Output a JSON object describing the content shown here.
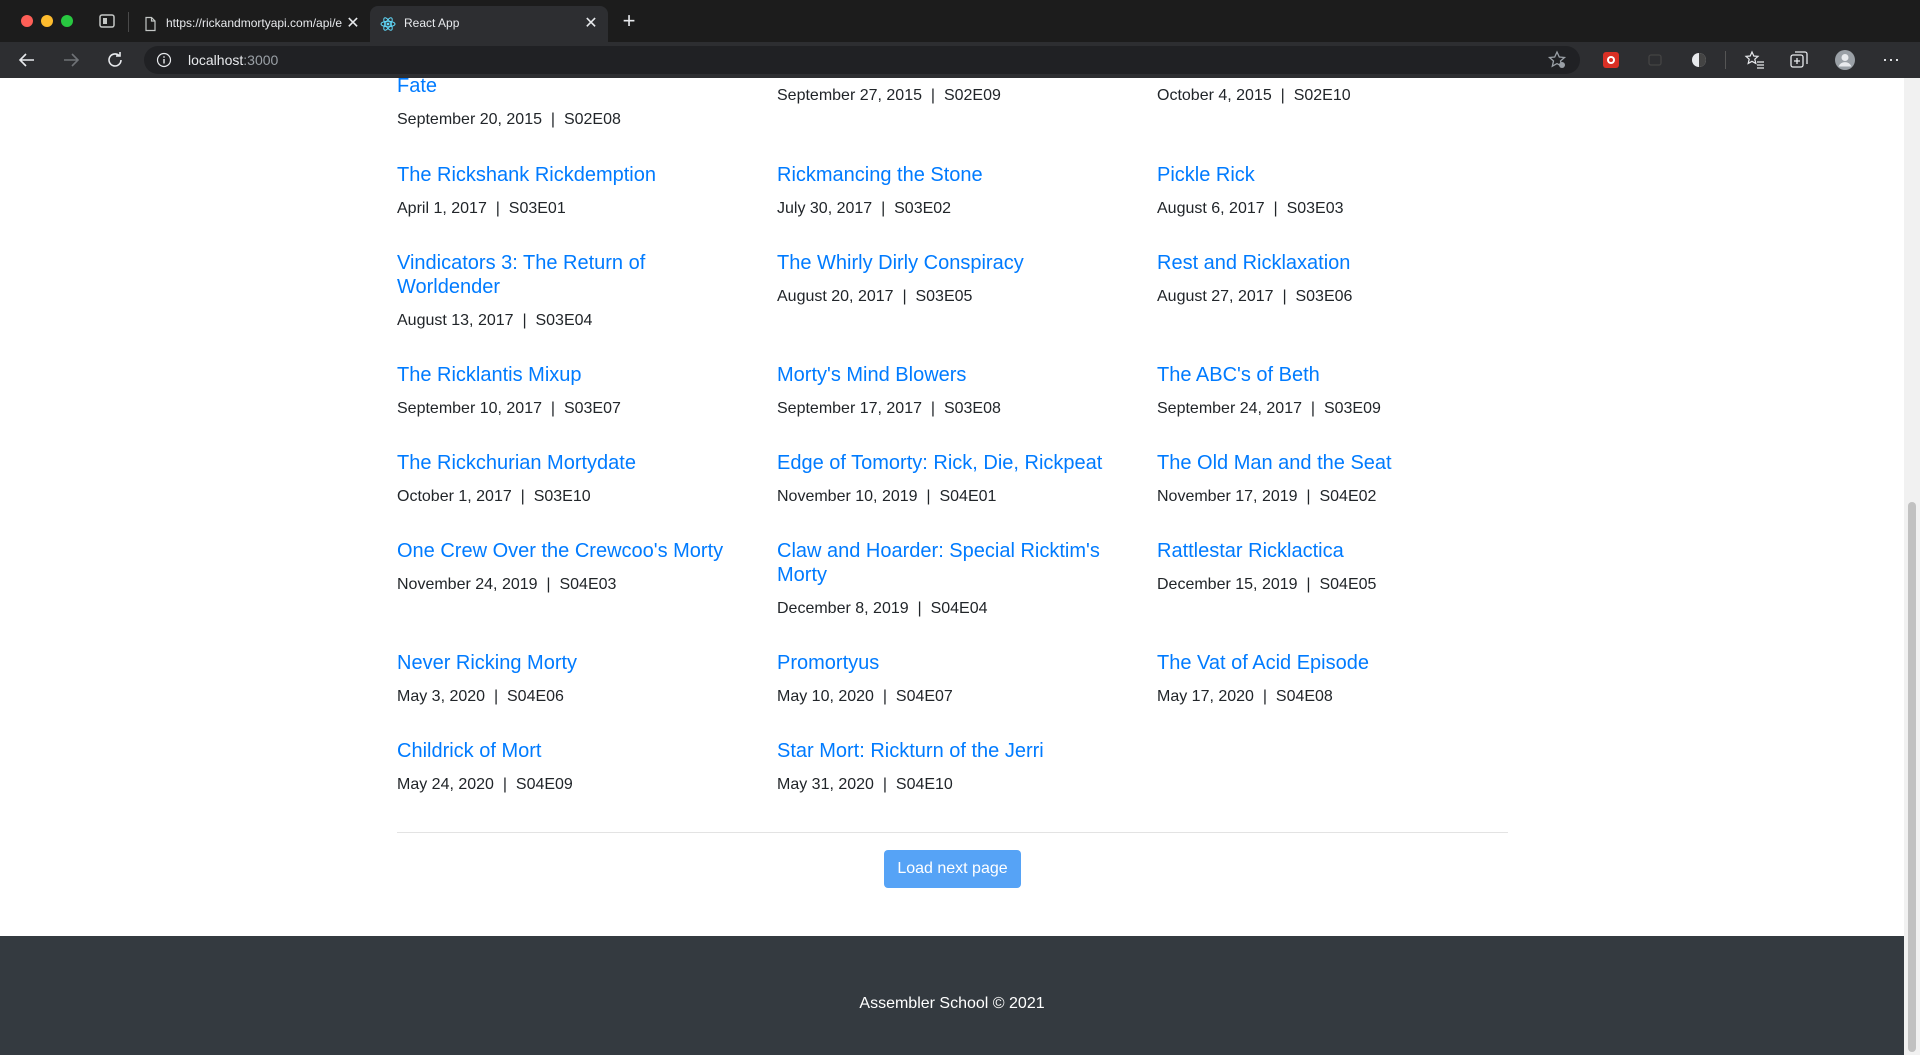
{
  "browser": {
    "tabs": [
      {
        "title": "https://rickandmortyapi.com/api/episode",
        "icon": "page-icon",
        "active": false
      },
      {
        "title": "React App",
        "icon": "react-icon",
        "active": true
      }
    ],
    "new_tab": "+",
    "url": {
      "host": "localhost",
      "port": ":3000"
    },
    "close_symbol": "✕",
    "more_symbol": "⋯"
  },
  "episodes": [
    {
      "title": "Fate",
      "date": "September 20, 2015",
      "code": "S02E08"
    },
    {
      "title": "",
      "date": "September 27, 2015",
      "code": "S02E09"
    },
    {
      "title": "",
      "date": "October 4, 2015",
      "code": "S02E10"
    },
    {
      "title": "The Rickshank Rickdemption",
      "date": "April 1, 2017",
      "code": "S03E01"
    },
    {
      "title": "Rickmancing the Stone",
      "date": "July 30, 2017",
      "code": "S03E02"
    },
    {
      "title": "Pickle Rick",
      "date": "August 6, 2017",
      "code": "S03E03"
    },
    {
      "title": "Vindicators 3: The Return of Worldender",
      "date": "August 13, 2017",
      "code": "S03E04"
    },
    {
      "title": "The Whirly Dirly Conspiracy",
      "date": "August 20, 2017",
      "code": "S03E05"
    },
    {
      "title": "Rest and Ricklaxation",
      "date": "August 27, 2017",
      "code": "S03E06"
    },
    {
      "title": "The Ricklantis Mixup",
      "date": "September 10, 2017",
      "code": "S03E07"
    },
    {
      "title": "Morty's Mind Blowers",
      "date": "September 17, 2017",
      "code": "S03E08"
    },
    {
      "title": "The ABC's of Beth",
      "date": "September 24, 2017",
      "code": "S03E09"
    },
    {
      "title": "The Rickchurian Mortydate",
      "date": "October 1, 2017",
      "code": "S03E10"
    },
    {
      "title": "Edge of Tomorty: Rick, Die, Rickpeat",
      "date": "November 10, 2019",
      "code": "S04E01"
    },
    {
      "title": "The Old Man and the Seat",
      "date": "November 17, 2019",
      "code": "S04E02"
    },
    {
      "title": "One Crew Over the Crewcoo's Morty",
      "date": "November 24, 2019",
      "code": "S04E03"
    },
    {
      "title": "Claw and Hoarder: Special Ricktim's Morty",
      "date": "December 8, 2019",
      "code": "S04E04"
    },
    {
      "title": "Rattlestar Ricklactica",
      "date": "December 15, 2019",
      "code": "S04E05"
    },
    {
      "title": "Never Ricking Morty",
      "date": "May 3, 2020",
      "code": "S04E06"
    },
    {
      "title": "Promortyus",
      "date": "May 10, 2020",
      "code": "S04E07"
    },
    {
      "title": "The Vat of Acid Episode",
      "date": "May 17, 2020",
      "code": "S04E08"
    },
    {
      "title": "Childrick of Mort",
      "date": "May 24, 2020",
      "code": "S04E09"
    },
    {
      "title": "Star Mort: Rickturn of the Jerri",
      "date": "May 31, 2020",
      "code": "S04E10"
    }
  ],
  "meta_separator": "  |  ",
  "load_button": "Load next page",
  "footer": "Assembler School © 2021",
  "colors": {
    "link": "#007bff",
    "button": "#56a3f6",
    "footer_bg": "#343a40"
  }
}
